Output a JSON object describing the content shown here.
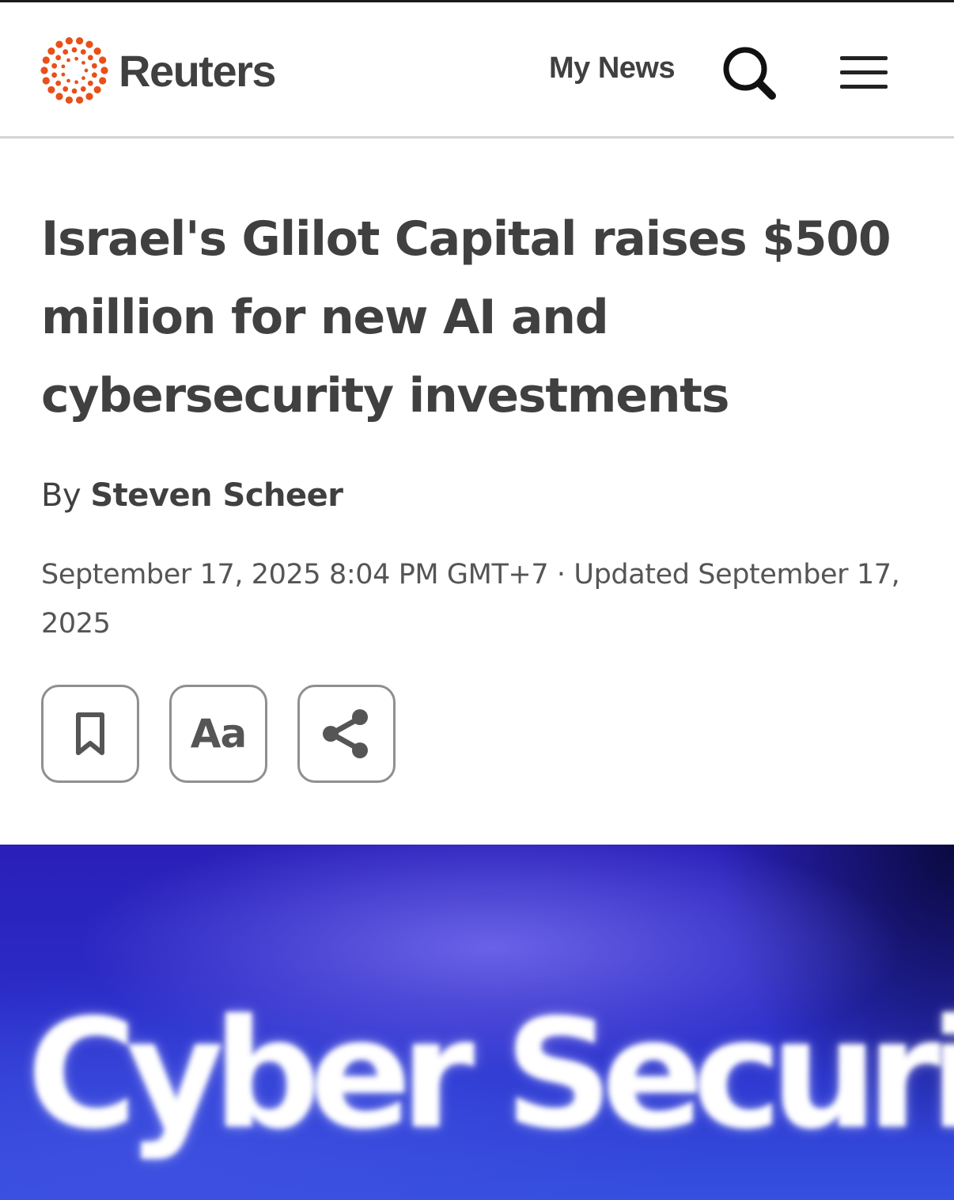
{
  "header": {
    "brand": "Reuters",
    "my_news_label": "My News",
    "icons": {
      "logo": "reuters-dot-ring-logo",
      "search": "search-icon",
      "menu": "hamburger-menu-icon"
    },
    "colors": {
      "brand_orange": "#e8501a",
      "text": "#404040"
    }
  },
  "article": {
    "headline": "Israel's Glilot Capital raises $500 million for new AI and cybersecurity investments",
    "byline_prefix": "By",
    "author": "Steven Scheer",
    "dateline": "September 17, 2025 8:04 PM GMT+7 · Updated September 17, 2025",
    "tools": {
      "bookmark_icon": "bookmark-icon",
      "text_size_label": "Aa",
      "share_icon": "share-icon"
    }
  },
  "hero_image": {
    "text": "Cyber Security",
    "background_color": "#2b2cc8"
  }
}
